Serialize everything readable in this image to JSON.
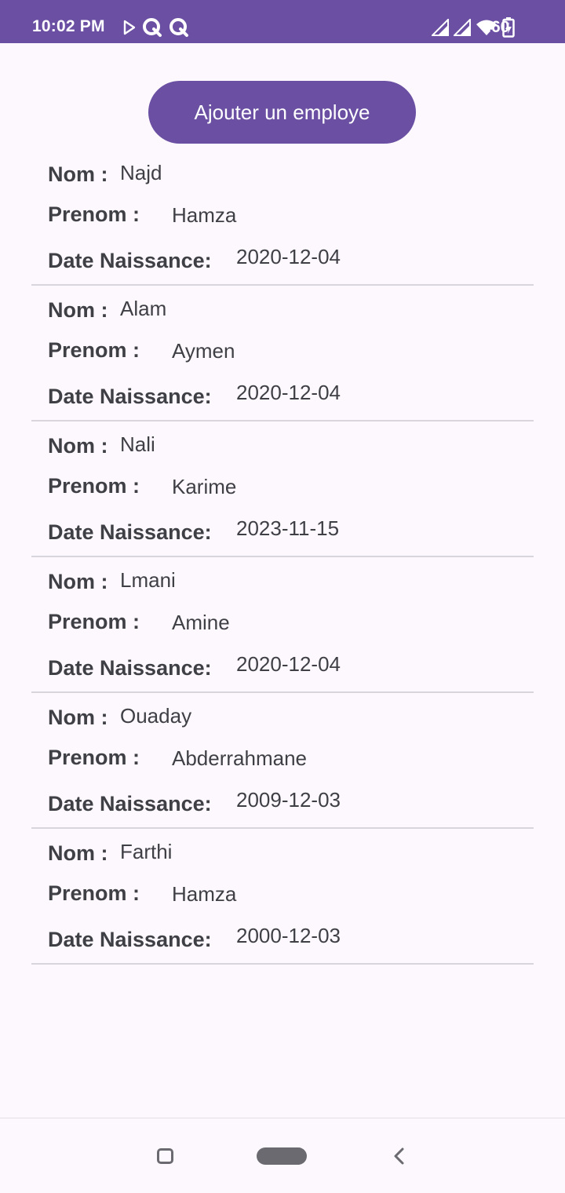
{
  "status_bar": {
    "time": "10:02 PM",
    "left_icons": [
      "play-store-icon",
      "q-app-icon",
      "q-app-icon"
    ],
    "right_icons": [
      "signal-icon",
      "signal-icon",
      "wifi-icon",
      "battery-charging-icon"
    ],
    "battery_level": "60"
  },
  "add_button": {
    "label": "Ajouter un employe"
  },
  "labels": {
    "nom": "Nom :",
    "prenom": "Prenom :",
    "date_naissance": "Date Naissance:"
  },
  "employees": [
    {
      "nom": "Najd",
      "prenom": "Hamza",
      "date_naissance": "2020-12-04"
    },
    {
      "nom": "Alam",
      "prenom": "Aymen",
      "date_naissance": "2020-12-04"
    },
    {
      "nom": "Nali",
      "prenom": "Karime",
      "date_naissance": "2023-11-15"
    },
    {
      "nom": "Lmani",
      "prenom": "Amine",
      "date_naissance": "2020-12-04"
    },
    {
      "nom": "Ouaday",
      "prenom": "Abderrahmane",
      "date_naissance": "2009-12-03"
    },
    {
      "nom": "Farthi",
      "prenom": "Hamza",
      "date_naissance": "2000-12-03"
    }
  ],
  "nav_bar": {
    "icons": [
      "recents-icon",
      "home-pill-icon",
      "back-icon"
    ]
  },
  "colors": {
    "primary": "#6a4fa3",
    "background": "#fdf8fd",
    "text": "#3f3f46",
    "divider": "#d9d5dc"
  }
}
